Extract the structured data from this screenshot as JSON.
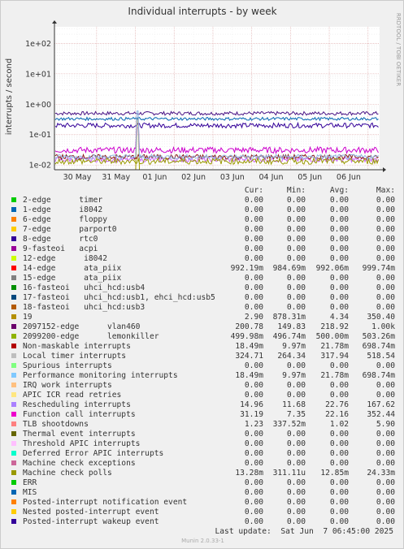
{
  "chart_data": {
    "type": "line",
    "title": "Individual interrupts - by week",
    "ylabel": "interrupts / second",
    "yscale": "log",
    "ylim": [
      0.007,
      350
    ],
    "y_ticks": [
      {
        "value": 0.01,
        "label": "1e-02"
      },
      {
        "value": 0.1,
        "label": "1e-01"
      },
      {
        "value": 1,
        "label": "1e+00"
      },
      {
        "value": 10,
        "label": "1e+01"
      },
      {
        "value": 100,
        "label": "1e+02"
      }
    ],
    "x_ticks": [
      "30 May",
      "31 May",
      "01 Jun",
      "02 Jun",
      "03 Jun",
      "04 Jun",
      "05 Jun",
      "06 Jun"
    ],
    "grid": true,
    "side_label": "RRDTOOL / TOBI OETIKER",
    "series": [
      {
        "name": "2099200-edge lemonkiller",
        "color": "#4a1486",
        "level": 0.5,
        "spike": null,
        "noise": 0.06
      },
      {
        "name": "2097152-edge vlan460",
        "color": "#330099",
        "level": 0.2,
        "spike": null,
        "noise": 0.08
      },
      {
        "name": "Function call interrupts",
        "color": "#cc00cc",
        "level": 0.031,
        "spike": 0.35,
        "noise": 0.1
      },
      {
        "name": "Rescheduling interrupts",
        "color": "#cc66ff",
        "level": 0.015,
        "spike": 0.17,
        "noise": 0.08
      },
      {
        "name": "19",
        "color": "#a0a000",
        "level": 0.0029,
        "spike": 0.35,
        "noise": 0.25
      },
      {
        "name": "Local timer interrupts",
        "color": "#0066b3",
        "level": 0.33,
        "spike": null,
        "noise": 0.05
      },
      {
        "name": "TLB shootdowns",
        "color": "#ff6666",
        "level": 0.0012,
        "spike": 0.006,
        "noise": 0.15
      },
      {
        "name": "14-edge ata_piix",
        "color": "#aa0000",
        "level": 0.00099,
        "spike": null,
        "noise": 0.01
      },
      {
        "name": "Non-maskable interrupts",
        "color": "#8b1a1a",
        "level": 0.0185,
        "spike": null,
        "noise": 0.08
      },
      {
        "name": "Performance monitoring interrupts",
        "color": "#8fb3e0",
        "level": 0.0185,
        "spike": 0.6,
        "noise": 0.08
      },
      {
        "name": "Machine check polls",
        "color": "#999900",
        "level": 0.0133,
        "spike": null,
        "noise": 0.1
      }
    ]
  },
  "legend": {
    "headers": [
      "Cur:",
      "Min:",
      "Avg:",
      "Max:"
    ],
    "rows": [
      {
        "label": "2-edge      timer",
        "color": "#00cc00",
        "cur": "0.00",
        "min": "0.00",
        "avg": "0.00",
        "max": "0.00"
      },
      {
        "label": "1-edge      i8042",
        "color": "#0066b3",
        "cur": "0.00",
        "min": "0.00",
        "avg": "0.00",
        "max": "0.00"
      },
      {
        "label": "6-edge      floppy",
        "color": "#ff8000",
        "cur": "0.00",
        "min": "0.00",
        "avg": "0.00",
        "max": "0.00"
      },
      {
        "label": "7-edge      parport0",
        "color": "#ffcc00",
        "cur": "0.00",
        "min": "0.00",
        "avg": "0.00",
        "max": "0.00"
      },
      {
        "label": "8-edge      rtc0",
        "color": "#330099",
        "cur": "0.00",
        "min": "0.00",
        "avg": "0.00",
        "max": "0.00"
      },
      {
        "label": "9-fasteoi   acpi",
        "color": "#990099",
        "cur": "0.00",
        "min": "0.00",
        "avg": "0.00",
        "max": "0.00"
      },
      {
        "label": "12-edge      i8042",
        "color": "#ccff00",
        "cur": "0.00",
        "min": "0.00",
        "avg": "0.00",
        "max": "0.00"
      },
      {
        "label": "14-edge      ata_piix",
        "color": "#ff0000",
        "cur": "992.19m",
        "min": "984.69m",
        "avg": "992.06m",
        "max": "999.74m"
      },
      {
        "label": "15-edge      ata_piix",
        "color": "#808080",
        "cur": "0.00",
        "min": "0.00",
        "avg": "0.00",
        "max": "0.00"
      },
      {
        "label": "16-fasteoi   uhci_hcd:usb4",
        "color": "#008f00",
        "cur": "0.00",
        "min": "0.00",
        "avg": "0.00",
        "max": "0.00"
      },
      {
        "label": "17-fasteoi   uhci_hcd:usb1, ehci_hcd:usb5",
        "color": "#00487d",
        "cur": "0.00",
        "min": "0.00",
        "avg": "0.00",
        "max": "0.00"
      },
      {
        "label": "18-fasteoi   uhci_hcd:usb3",
        "color": "#b35a00",
        "cur": "0.00",
        "min": "0.00",
        "avg": "0.00",
        "max": "0.00"
      },
      {
        "label": "19",
        "color": "#b38f00",
        "cur": "2.90",
        "min": "878.31m",
        "avg": "4.34",
        "max": "350.40"
      },
      {
        "label": "2097152-edge      vlan460",
        "color": "#6b006b",
        "cur": "200.78",
        "min": "149.83",
        "avg": "218.92",
        "max": "1.00k"
      },
      {
        "label": "2099200-edge      lemonkiller",
        "color": "#8fb300",
        "cur": "499.98m",
        "min": "496.74m",
        "avg": "500.00m",
        "max": "503.26m"
      },
      {
        "label": "Non-maskable interrupts",
        "color": "#b30000",
        "cur": "18.49m",
        "min": "9.97m",
        "avg": "21.78m",
        "max": "698.74m"
      },
      {
        "label": "Local timer interrupts",
        "color": "#bebebe",
        "cur": "324.71",
        "min": "264.34",
        "avg": "317.94",
        "max": "518.54"
      },
      {
        "label": "Spurious interrupts",
        "color": "#80ff80",
        "cur": "0.00",
        "min": "0.00",
        "avg": "0.00",
        "max": "0.00"
      },
      {
        "label": "Performance monitoring interrupts",
        "color": "#80c9ff",
        "cur": "18.49m",
        "min": "9.97m",
        "avg": "21.78m",
        "max": "698.74m"
      },
      {
        "label": "IRQ work interrupts",
        "color": "#ffc080",
        "cur": "0.00",
        "min": "0.00",
        "avg": "0.00",
        "max": "0.00"
      },
      {
        "label": "APIC ICR read retries",
        "color": "#ffe680",
        "cur": "0.00",
        "min": "0.00",
        "avg": "0.00",
        "max": "0.00"
      },
      {
        "label": "Rescheduling interrupts",
        "color": "#aa80ff",
        "cur": "14.96",
        "min": "11.68",
        "avg": "22.76",
        "max": "167.62"
      },
      {
        "label": "Function call interrupts",
        "color": "#ee00cc",
        "cur": "31.19",
        "min": "7.35",
        "avg": "22.16",
        "max": "352.44"
      },
      {
        "label": "TLB shootdowns",
        "color": "#ff8080",
        "cur": "1.23",
        "min": "337.52m",
        "avg": "1.02",
        "max": "5.90"
      },
      {
        "label": "Thermal event interrupts",
        "color": "#666600",
        "cur": "0.00",
        "min": "0.00",
        "avg": "0.00",
        "max": "0.00"
      },
      {
        "label": "Threshold APIC interrupts",
        "color": "#ffbfff",
        "cur": "0.00",
        "min": "0.00",
        "avg": "0.00",
        "max": "0.00"
      },
      {
        "label": "Deferred Error APIC interrupts",
        "color": "#00ffcc",
        "cur": "0.00",
        "min": "0.00",
        "avg": "0.00",
        "max": "0.00"
      },
      {
        "label": "Machine check exceptions",
        "color": "#cc6699",
        "cur": "0.00",
        "min": "0.00",
        "avg": "0.00",
        "max": "0.00"
      },
      {
        "label": "Machine check polls",
        "color": "#999900",
        "cur": "13.28m",
        "min": "311.11u",
        "avg": "12.85m",
        "max": "24.33m"
      },
      {
        "label": "ERR",
        "color": "#00cc00",
        "cur": "0.00",
        "min": "0.00",
        "avg": "0.00",
        "max": "0.00"
      },
      {
        "label": "MIS",
        "color": "#0066b3",
        "cur": "0.00",
        "min": "0.00",
        "avg": "0.00",
        "max": "0.00"
      },
      {
        "label": "Posted-interrupt notification event",
        "color": "#ff8000",
        "cur": "0.00",
        "min": "0.00",
        "avg": "0.00",
        "max": "0.00"
      },
      {
        "label": "Nested posted-interrupt event",
        "color": "#ffcc00",
        "cur": "0.00",
        "min": "0.00",
        "avg": "0.00",
        "max": "0.00"
      },
      {
        "label": "Posted-interrupt wakeup event",
        "color": "#330099",
        "cur": "0.00",
        "min": "0.00",
        "avg": "0.00",
        "max": "0.00"
      }
    ]
  },
  "last_update": "Last update:  Sat Jun  7 06:45:00 2025",
  "version": "Munin 2.0.33-1"
}
